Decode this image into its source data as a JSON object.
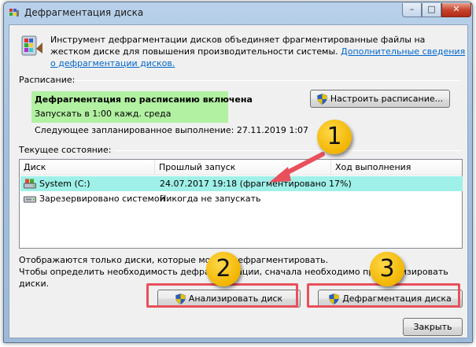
{
  "window": {
    "title": "Дефрагментация диска",
    "controls": {
      "minimize": "–",
      "maximize": "□",
      "close": "✕"
    }
  },
  "intro": {
    "text": "Инструмент дефрагментации дисков объединяет фрагментированные файлы на жестком диске для повышения производительности системы. ",
    "link": "Дополнительные сведения о дефрагментации дисков."
  },
  "schedule": {
    "label": "Расписание:",
    "status": "Дефрагментация по расписанию включена",
    "run_text": "Запускать в 1:00 кажд. среда",
    "next_run": "Следующее запланированное выполнение: 27.11.2019 1:07",
    "configure_button": "Настроить расписание..."
  },
  "current": {
    "label": "Текущее состояние:",
    "columns": [
      "Диск",
      "Прошлый запуск",
      "Ход выполнения"
    ],
    "rows": [
      {
        "disk": "System (C:)",
        "last_run": "24.07.2017 19:18 (фрагментировано 17%)",
        "progress": "",
        "selected": true
      },
      {
        "disk": "Зарезервировано системой",
        "last_run": "Никогда не запускать",
        "progress": "",
        "selected": false
      }
    ]
  },
  "notes": {
    "line1": "Отображаются только диски, которые можно дефрагментировать.",
    "line2": "Чтобы определить необходимость дефрагментации, сначала необходимо проанализировать диски."
  },
  "buttons": {
    "analyze": "Анализировать диск",
    "defrag": "Дефрагментация диска",
    "close": "Закрыть"
  },
  "annotations": {
    "badge1": "1",
    "badge2": "2",
    "badge3": "3"
  },
  "colors": {
    "schedule_highlight": "#b2f0a2",
    "selected_row": "#9ff0e8",
    "annotation_red": "#e8505b",
    "badge_yellow": "#f2b500",
    "link": "#0066cc"
  }
}
